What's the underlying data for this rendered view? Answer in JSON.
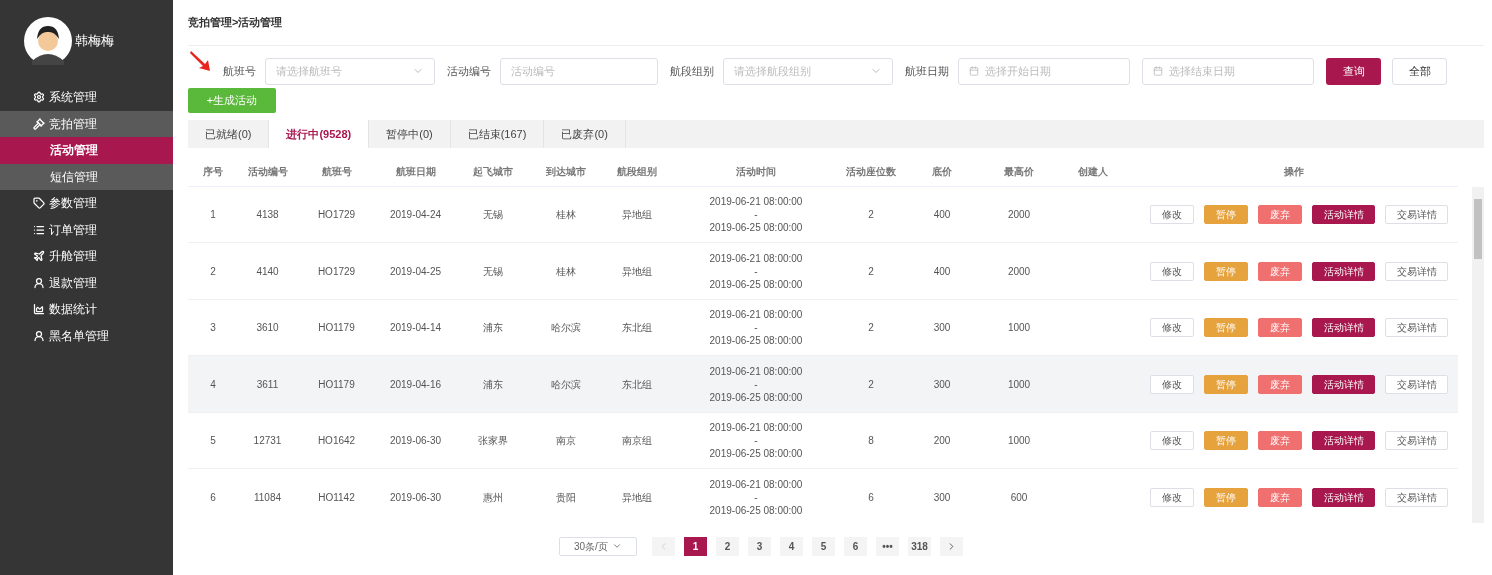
{
  "sidebar": {
    "user": {
      "name": "韩梅梅"
    },
    "items": [
      {
        "label": "系统管理",
        "expanded": false
      },
      {
        "label": "竞拍管理",
        "expanded": true,
        "children": [
          {
            "label": "活动管理",
            "selected": true
          },
          {
            "label": "短信管理",
            "selected": false
          }
        ]
      },
      {
        "label": "参数管理",
        "expanded": false
      },
      {
        "label": "订单管理",
        "expanded": false
      },
      {
        "label": "升舱管理",
        "expanded": false
      },
      {
        "label": "退款管理",
        "expanded": false
      },
      {
        "label": "数据统计",
        "expanded": false
      },
      {
        "label": "黑名单管理",
        "expanded": false
      }
    ]
  },
  "breadcrumb": "竞拍管理>活动管理",
  "filters": [
    {
      "kind": "select",
      "label": "航班号",
      "placeholder": "请选择航班号"
    },
    {
      "kind": "text",
      "label": "活动编号",
      "placeholder": "活动编号"
    },
    {
      "kind": "select",
      "label": "航段组别",
      "placeholder": "请选择航段组别"
    },
    {
      "kind": "date",
      "label": "航班日期",
      "placeholder": "选择开始日期"
    },
    {
      "kind": "date",
      "placeholder": "选择结束日期"
    }
  ],
  "filter_buttons": [
    {
      "label": "查询",
      "kind": "primary"
    },
    {
      "label": "全部",
      "kind": "default"
    }
  ],
  "create_button": "+生成活动",
  "tabs": [
    {
      "label": "已就绪(0)",
      "selected": false
    },
    {
      "label": "进行中(9528)",
      "selected": true
    },
    {
      "label": "暂停中(0)",
      "selected": false
    },
    {
      "label": "已结束(167)",
      "selected": false
    },
    {
      "label": "已废弃(0)",
      "selected": false
    }
  ],
  "table": {
    "columns": [
      "序号",
      "活动编号",
      "航班号",
      "航班日期",
      "起飞城市",
      "到达城市",
      "航段组别",
      "活动时间",
      "活动座位数",
      "底价",
      "最高价",
      "创建人",
      "操作"
    ],
    "rows": [
      {
        "highlighted": false,
        "cells": [
          "1",
          "4138",
          "HO1729",
          "2019-04-24",
          "无锡",
          "桂林",
          "异地组"
        ],
        "time": [
          "2019-06-21 08:00:00",
          "-",
          "2019-06-25 08:00:00"
        ],
        "tail": [
          "2",
          "400",
          "2000"
        ],
        "actions": [
          {
            "label": "修改",
            "kind": "default"
          },
          {
            "label": "暂停",
            "kind": "warning"
          },
          {
            "label": "废弃",
            "kind": "danger"
          },
          {
            "label": "活动详情",
            "kind": "primary"
          },
          {
            "label": "交易详情",
            "kind": "default"
          }
        ]
      },
      {
        "highlighted": false,
        "cells": [
          "2",
          "4140",
          "HO1729",
          "2019-04-25",
          "无锡",
          "桂林",
          "异地组"
        ],
        "time": [
          "2019-06-21 08:00:00",
          "-",
          "2019-06-25 08:00:00"
        ],
        "tail": [
          "2",
          "400",
          "2000"
        ],
        "actions": [
          {
            "label": "修改",
            "kind": "default"
          },
          {
            "label": "暂停",
            "kind": "warning"
          },
          {
            "label": "废弃",
            "kind": "danger"
          },
          {
            "label": "活动详情",
            "kind": "primary"
          },
          {
            "label": "交易详情",
            "kind": "default"
          }
        ]
      },
      {
        "highlighted": false,
        "cells": [
          "3",
          "3610",
          "HO1179",
          "2019-04-14",
          "浦东",
          "哈尔滨",
          "东北组"
        ],
        "time": [
          "2019-06-21 08:00:00",
          "-",
          "2019-06-25 08:00:00"
        ],
        "tail": [
          "2",
          "300",
          "1000"
        ],
        "actions": [
          {
            "label": "修改",
            "kind": "default"
          },
          {
            "label": "暂停",
            "kind": "warning"
          },
          {
            "label": "废弃",
            "kind": "danger"
          },
          {
            "label": "活动详情",
            "kind": "primary"
          },
          {
            "label": "交易详情",
            "kind": "default"
          }
        ]
      },
      {
        "highlighted": true,
        "cells": [
          "4",
          "3611",
          "HO1179",
          "2019-04-16",
          "浦东",
          "哈尔滨",
          "东北组"
        ],
        "time": [
          "2019-06-21 08:00:00",
          "-",
          "2019-06-25 08:00:00"
        ],
        "tail": [
          "2",
          "300",
          "1000"
        ],
        "actions": [
          {
            "label": "修改",
            "kind": "default"
          },
          {
            "label": "暂停",
            "kind": "warning"
          },
          {
            "label": "废弃",
            "kind": "danger"
          },
          {
            "label": "活动详情",
            "kind": "primary"
          },
          {
            "label": "交易详情",
            "kind": "default"
          }
        ]
      },
      {
        "highlighted": false,
        "cells": [
          "5",
          "12731",
          "HO1642",
          "2019-06-30",
          "张家界",
          "南京",
          "南京组"
        ],
        "time": [
          "2019-06-21 08:00:00",
          "-",
          "2019-06-25 08:00:00"
        ],
        "tail": [
          "8",
          "200",
          "1000"
        ],
        "actions": [
          {
            "label": "修改",
            "kind": "default"
          },
          {
            "label": "暂停",
            "kind": "warning"
          },
          {
            "label": "废弃",
            "kind": "danger"
          },
          {
            "label": "活动详情",
            "kind": "primary"
          },
          {
            "label": "交易详情",
            "kind": "default"
          }
        ]
      },
      {
        "highlighted": false,
        "cells": [
          "6",
          "11084",
          "HO1142",
          "2019-06-30",
          "惠州",
          "贵阳",
          "异地组"
        ],
        "time": [
          "2019-06-21 08:00:00",
          "-",
          "2019-06-25 08:00:00"
        ],
        "tail": [
          "6",
          "300",
          "600"
        ],
        "actions": [
          {
            "label": "修改",
            "kind": "default"
          },
          {
            "label": "暂停",
            "kind": "warning"
          },
          {
            "label": "废弃",
            "kind": "danger"
          },
          {
            "label": "活动详情",
            "kind": "primary"
          },
          {
            "label": "交易详情",
            "kind": "default"
          }
        ]
      }
    ]
  },
  "pagination": {
    "page_size": "30条/页",
    "pages": [
      {
        "label": "1",
        "selected": true
      },
      {
        "label": "2",
        "selected": false
      },
      {
        "label": "3",
        "selected": false
      },
      {
        "label": "4",
        "selected": false
      },
      {
        "label": "5",
        "selected": false
      },
      {
        "label": "6",
        "selected": false
      },
      {
        "label": "•••",
        "selected": false
      },
      {
        "label": "318",
        "selected": false
      }
    ]
  }
}
